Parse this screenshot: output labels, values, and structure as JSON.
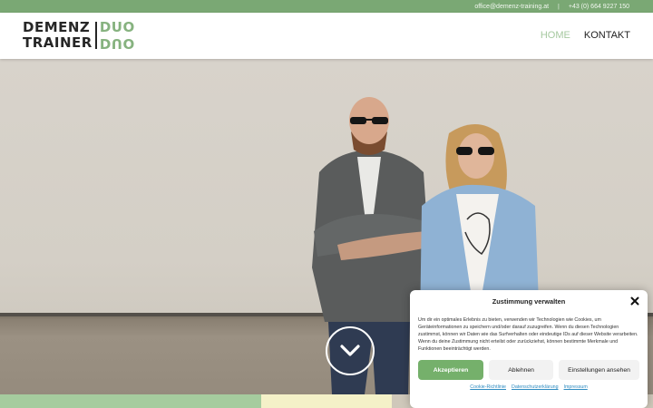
{
  "topbar": {
    "email": "office@demenz-training.at",
    "separator": "|",
    "phone": "+43 (0) 664 9227 150",
    "bg_color": "#7aa874"
  },
  "logo": {
    "line1_left": "DEMENZ",
    "line2_left": "TRAINER",
    "line1_right": "DUO",
    "line2_right": "DUO",
    "accent_color": "#86b27f"
  },
  "nav": {
    "items": [
      {
        "label": "HOME",
        "active": true
      },
      {
        "label": "KONTAKT",
        "active": false
      }
    ]
  },
  "hero": {
    "scroll_icon": "chevron-down-icon"
  },
  "consent": {
    "title": "Zustimmung verwalten",
    "close_icon": "close-icon",
    "text": "Um dir ein optimales Erlebnis zu bieten, verwenden wir Technologien wie Cookies, um Geräteinformationen zu speichern und/oder darauf zuzugreifen. Wenn du diesen Technologien zustimmst, können wir Daten wie das Surfverhalten oder eindeutige IDs auf dieser Website verarbeiten. Wenn du deine Zustimmung nicht erteilst oder zurückziehst, können bestimmte Merkmale und Funktionen beeinträchtigt werden.",
    "buttons": {
      "accept": "Akzeptieren",
      "deny": "Ablehnen",
      "settings": "Einstellungen ansehen"
    },
    "links": {
      "cookie": "Cookie-Richtlinie",
      "privacy": "Datenschutzerklärung",
      "imprint": "Impressum"
    },
    "accept_color": "#75b06b",
    "link_color": "#2e8bc0"
  }
}
